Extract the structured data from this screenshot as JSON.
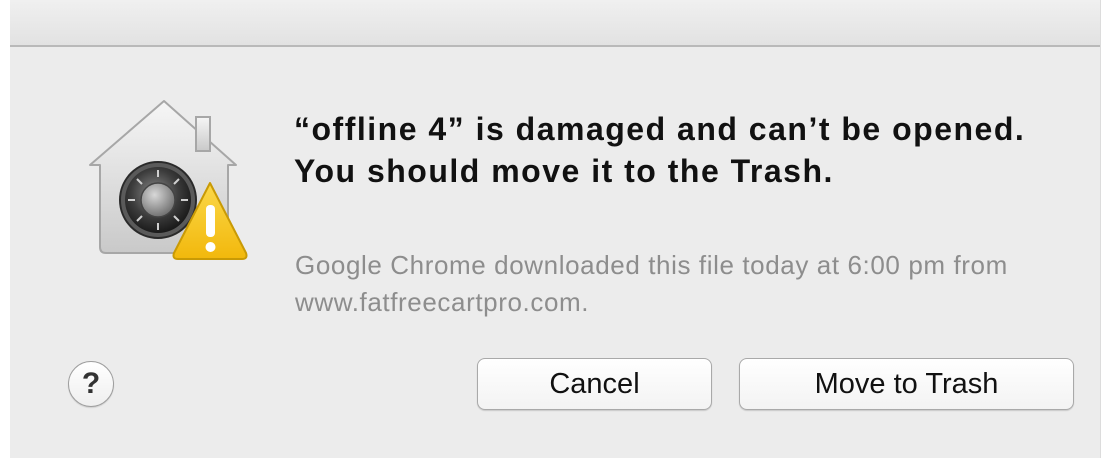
{
  "dialog": {
    "icon": "gatekeeper-warning-icon",
    "message_text": "“offline 4” is damaged and can’t be opened. You should move it to the Trash.",
    "informative_text": "Google Chrome downloaded this file today at 6:00 pm from www.fatfreecartpro.com.",
    "help_label": "?",
    "cancel_label": "Cancel",
    "move_to_trash_label": "Move to Trash"
  },
  "colors": {
    "background": "#ececec",
    "message": "#111111",
    "informative": "#8d8d8d",
    "warning_triangle": "#f7c51c"
  }
}
